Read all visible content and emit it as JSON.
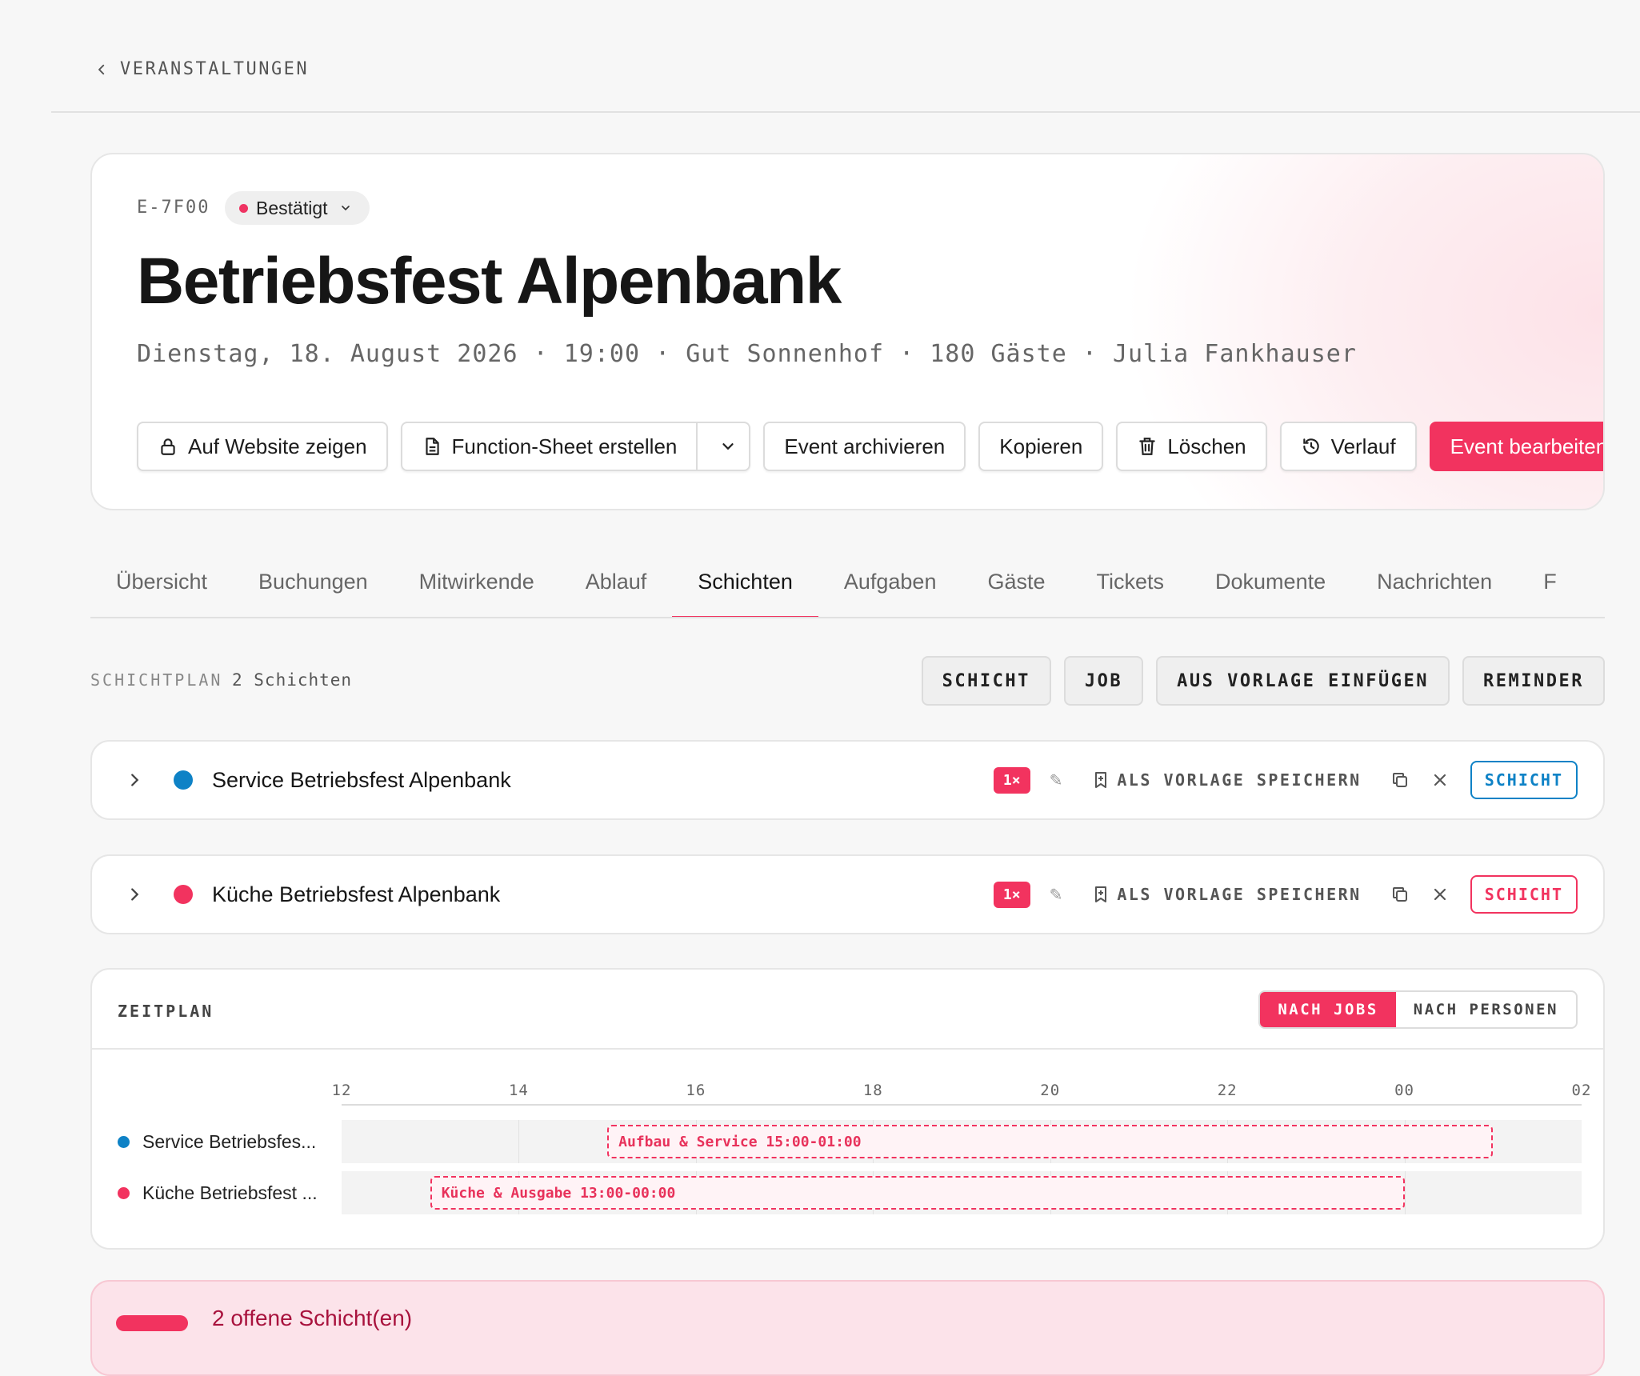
{
  "breadcrumb": {
    "label": "VERANSTALTUNGEN"
  },
  "event": {
    "id": "E-7F00",
    "status": "Bestätigt",
    "title": "Betriebsfest Alpenbank",
    "meta": "Dienstag, 18. August 2026 · 19:00 · Gut Sonnenhof · 180 Gäste · Julia Fankhauser"
  },
  "actions": {
    "website": "Auf Website zeigen",
    "function_sheet": "Function-Sheet erstellen",
    "archive": "Event archivieren",
    "copy": "Kopieren",
    "delete": "Löschen",
    "history": "Verlauf",
    "edit": "Event bearbeiten"
  },
  "tabs": [
    "Übersicht",
    "Buchungen",
    "Mitwirkende",
    "Ablauf",
    "Schichten",
    "Aufgaben",
    "Gäste",
    "Tickets",
    "Dokumente",
    "Nachrichten",
    "F"
  ],
  "active_tab": "Schichten",
  "shift_plan": {
    "label": "SCHICHTPLAN",
    "count": "2 Schichten",
    "buttons": [
      "SCHICHT",
      "JOB",
      "AUS VORLAGE EINFÜGEN",
      "REMINDER"
    ]
  },
  "shifts": [
    {
      "name": "Service Betriebsfest Alpenbank",
      "color": "#0e82c6",
      "badge": "1×",
      "save_template": "ALS VORLAGE SPEICHERN",
      "button": "SCHICHT"
    },
    {
      "name": "Küche Betriebsfest Alpenbank",
      "color": "#f2335f",
      "badge": "1×",
      "save_template": "ALS VORLAGE SPEICHERN",
      "button": "SCHICHT"
    }
  ],
  "timeline": {
    "title": "ZEITPLAN",
    "view_jobs": "NACH JOBS",
    "view_persons": "NACH PERSONEN",
    "ticks": [
      "12",
      "14",
      "16",
      "18",
      "20",
      "22",
      "00",
      "02"
    ],
    "lanes": [
      {
        "label": "Service Betriebsfes...",
        "color": "#0e82c6",
        "bar": "Aufbau & Service 15:00-01:00",
        "start": 15,
        "end": 25
      },
      {
        "label": "Küche Betriebsfest ...",
        "color": "#f2335f",
        "bar": "Küche & Ausgabe 13:00-00:00",
        "start": 13,
        "end": 24
      }
    ]
  },
  "open_shifts": {
    "text": "2 offene Schicht(en)"
  }
}
